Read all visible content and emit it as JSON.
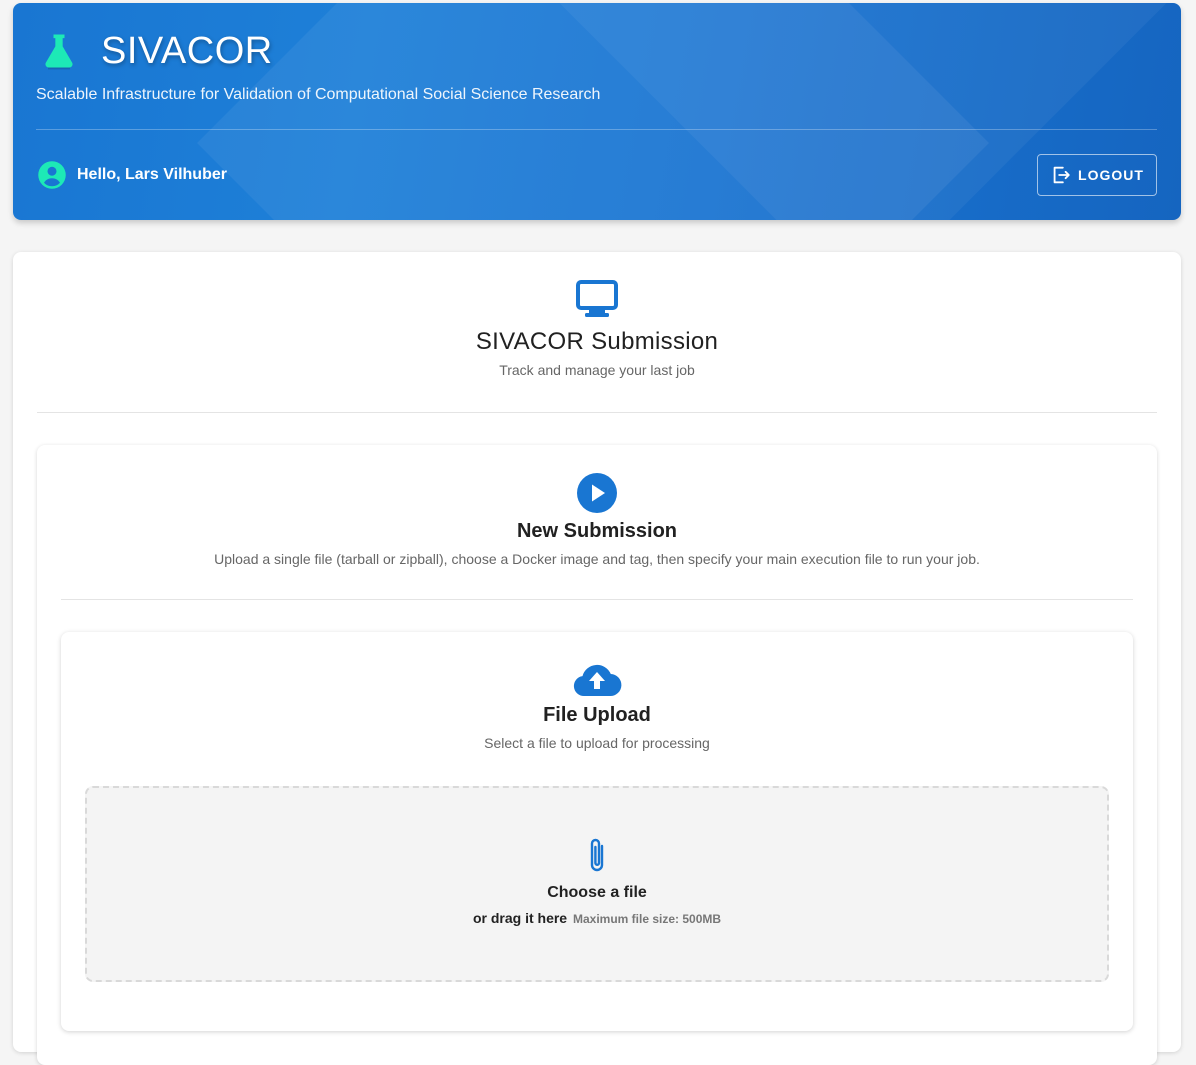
{
  "header": {
    "title": "SIVACOR",
    "subtitle": "Scalable Infrastructure for Validation of Computational Social Science Research",
    "greeting": "Hello, Lars Vilhuber",
    "logout_label": "LOGOUT"
  },
  "main": {
    "title": "SIVACOR Submission",
    "subtitle": "Track and manage your last job"
  },
  "new_submission": {
    "title": "New Submission",
    "description": "Upload a single file (tarball or zipball), choose a Docker image and tag, then specify your main execution file to run your job."
  },
  "file_upload": {
    "title": "File Upload",
    "subtitle": "Select a file to upload for processing",
    "choose_label": "Choose a file",
    "drag_label": "or drag it here",
    "max_size": "Maximum file size: 500MB"
  },
  "icons": {
    "brand": "flask-icon",
    "user": "account-circle-icon",
    "logout": "logout-icon",
    "main": "monitor-icon",
    "submission": "play-circle-icon",
    "upload": "cloud-upload-icon",
    "file": "paperclip-icon"
  },
  "colors": {
    "header_blue": "#1976d2",
    "accent_teal": "#1de9b6",
    "icon_blue": "#1976d2"
  }
}
